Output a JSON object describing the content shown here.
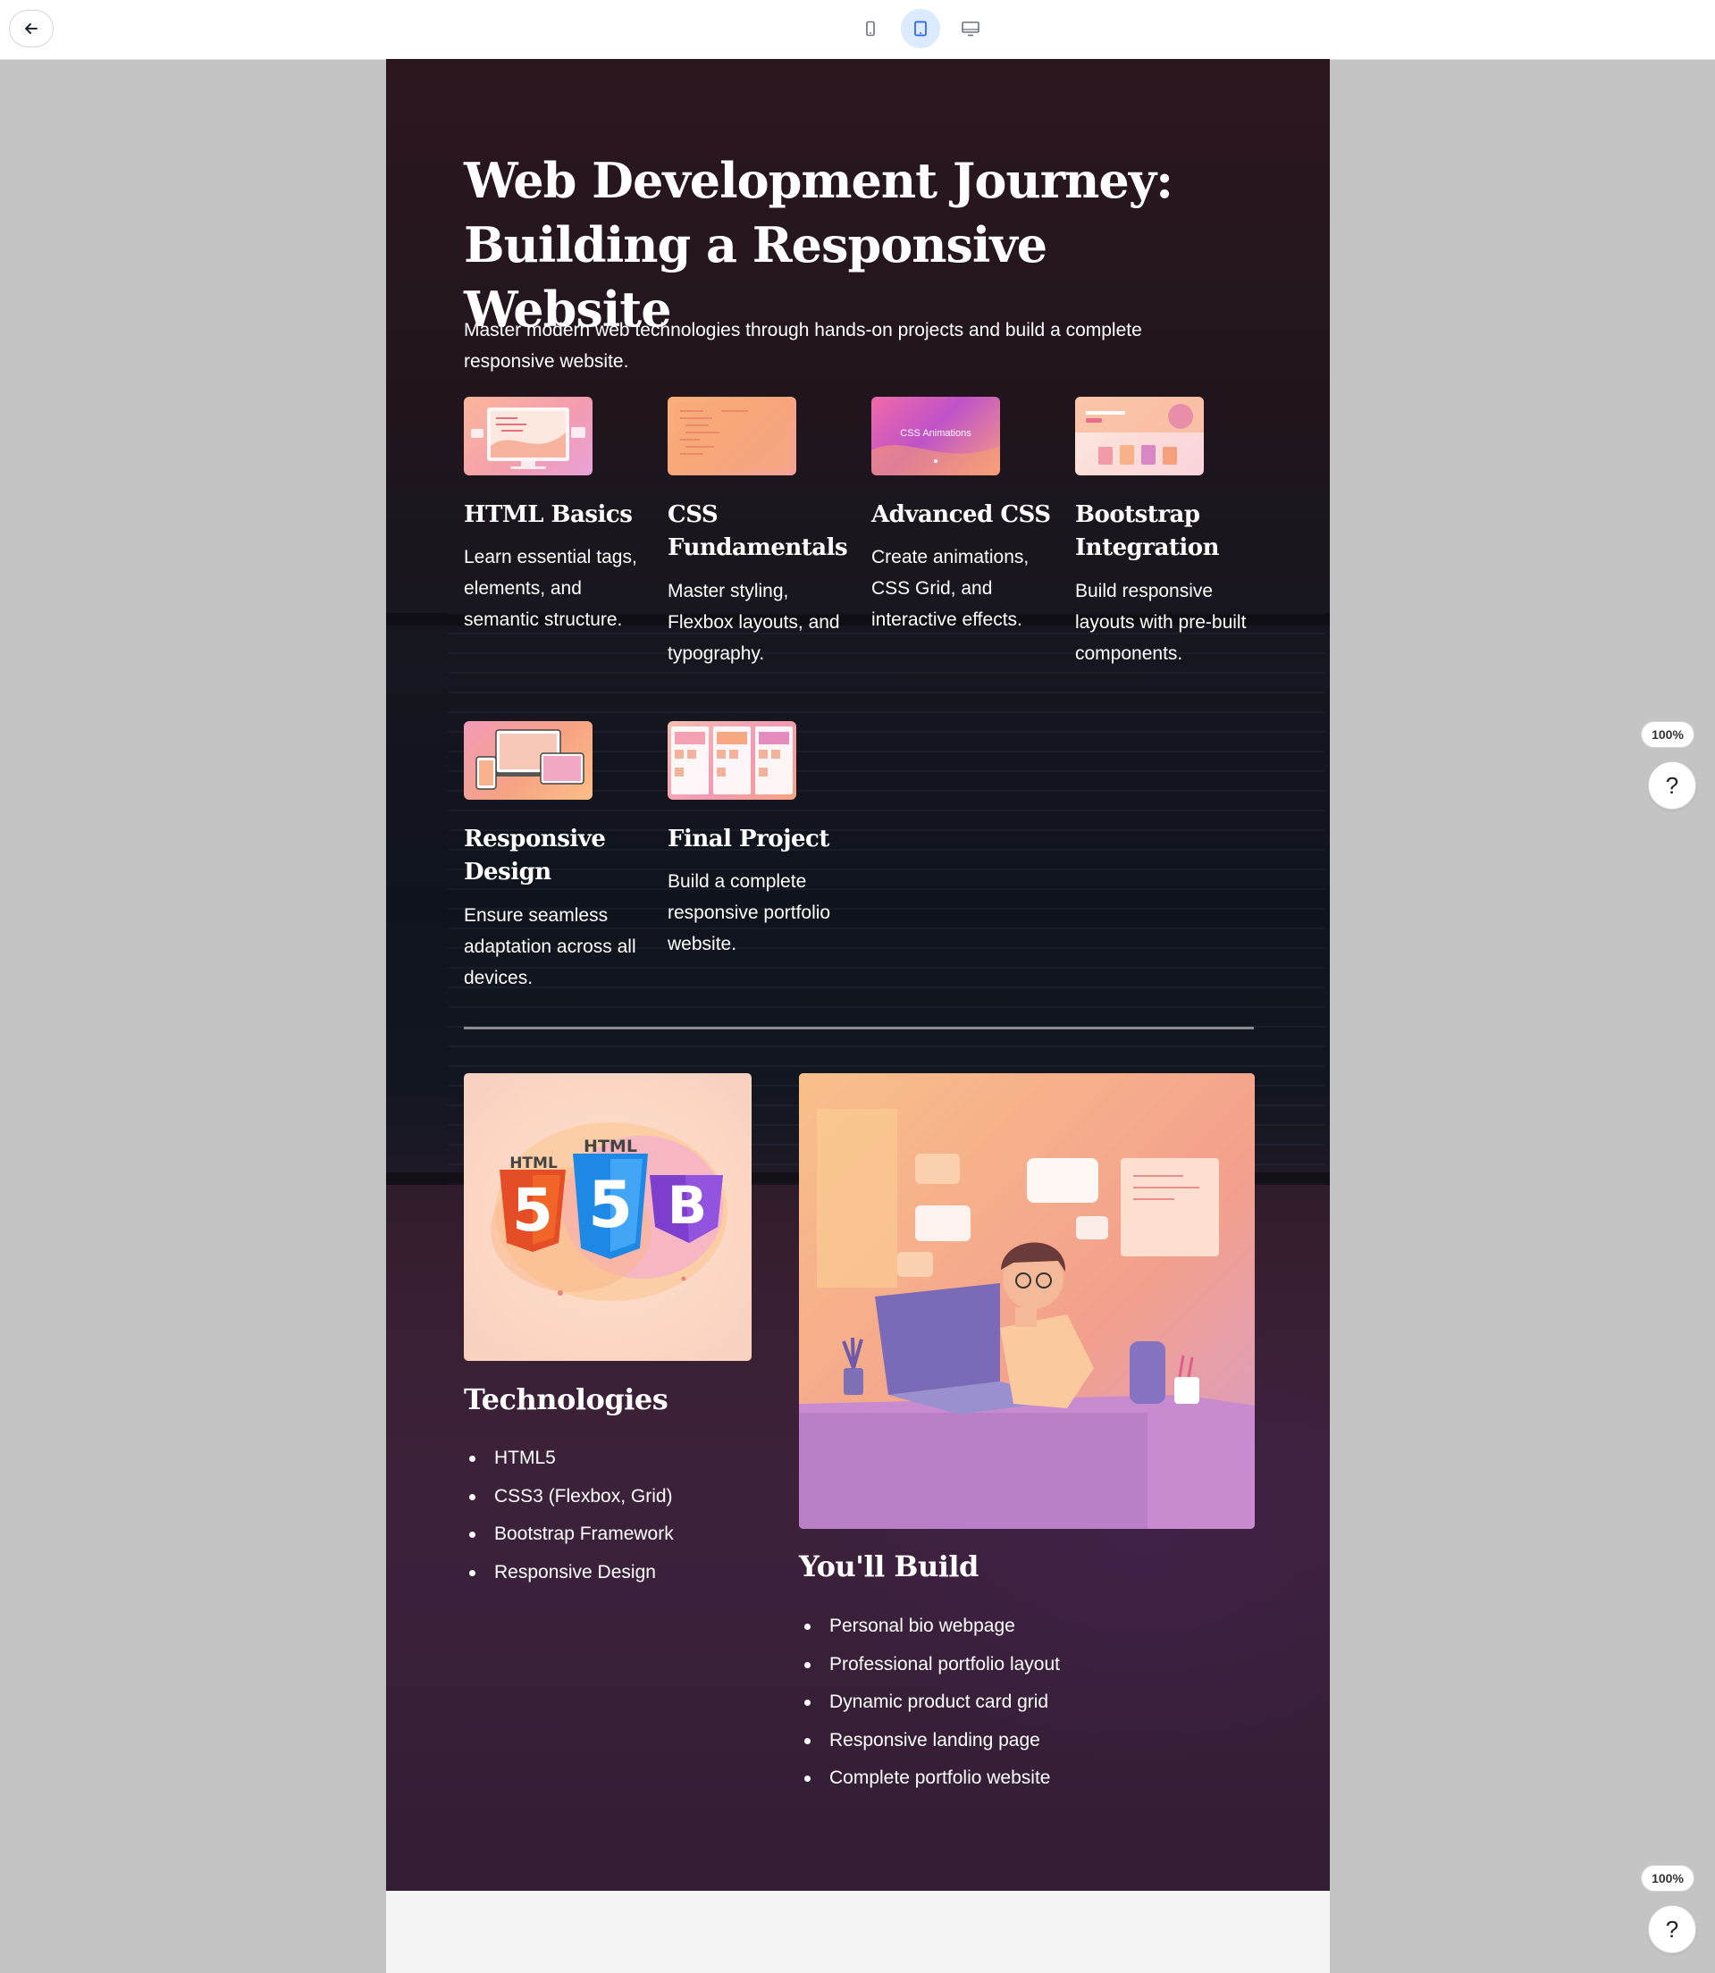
{
  "toolbar": {
    "back_icon": "arrow-left-icon",
    "devices": [
      {
        "name": "mobile",
        "icon": "phone-icon"
      },
      {
        "name": "tablet",
        "icon": "tablet-icon",
        "active": true
      },
      {
        "name": "desktop",
        "icon": "desktop-icon"
      }
    ]
  },
  "hero": {
    "title_line1": "Web Development Journey:",
    "title_line2": "Building a Responsive Website",
    "subtitle": "Master modern web technologies through hands-on projects and build a complete responsive website."
  },
  "modules": [
    {
      "title": "HTML Basics",
      "description": "Learn essential tags, elements, and semantic structure."
    },
    {
      "title": "CSS Fundamentals",
      "description": "Master styling, Flexbox layouts, and typography."
    },
    {
      "title": "Advanced CSS",
      "description": "Create animations, CSS Grid, and interactive effects.",
      "thumb_label": "CSS Animations"
    },
    {
      "title": "Bootstrap Integration",
      "description": "Build responsive layouts with pre-built components."
    },
    {
      "title": "Responsive Design",
      "description": "Ensure seamless adaptation across all devices."
    },
    {
      "title": "Final Project",
      "description": "Build a complete responsive portfolio website."
    }
  ],
  "technologies": {
    "logo_text": [
      "HTML",
      "HTML",
      "5",
      "5",
      "B"
    ],
    "title": "Technologies",
    "items": [
      "HTML5",
      "CSS3 (Flexbox, Grid)",
      "Bootstrap Framework",
      "Responsive Design"
    ]
  },
  "build": {
    "title": "You'll Build",
    "items": [
      "Personal bio webpage",
      "Professional portfolio layout",
      "Dynamic product card grid",
      "Responsive landing page",
      "Complete portfolio website"
    ]
  },
  "widgets": {
    "zoom": "100%",
    "help": "?"
  },
  "colors": {
    "accent": "#3b82f6",
    "html5_orange": "#e44d26",
    "css3_blue": "#2196f3",
    "bootstrap_purple": "#7e3fcf"
  }
}
